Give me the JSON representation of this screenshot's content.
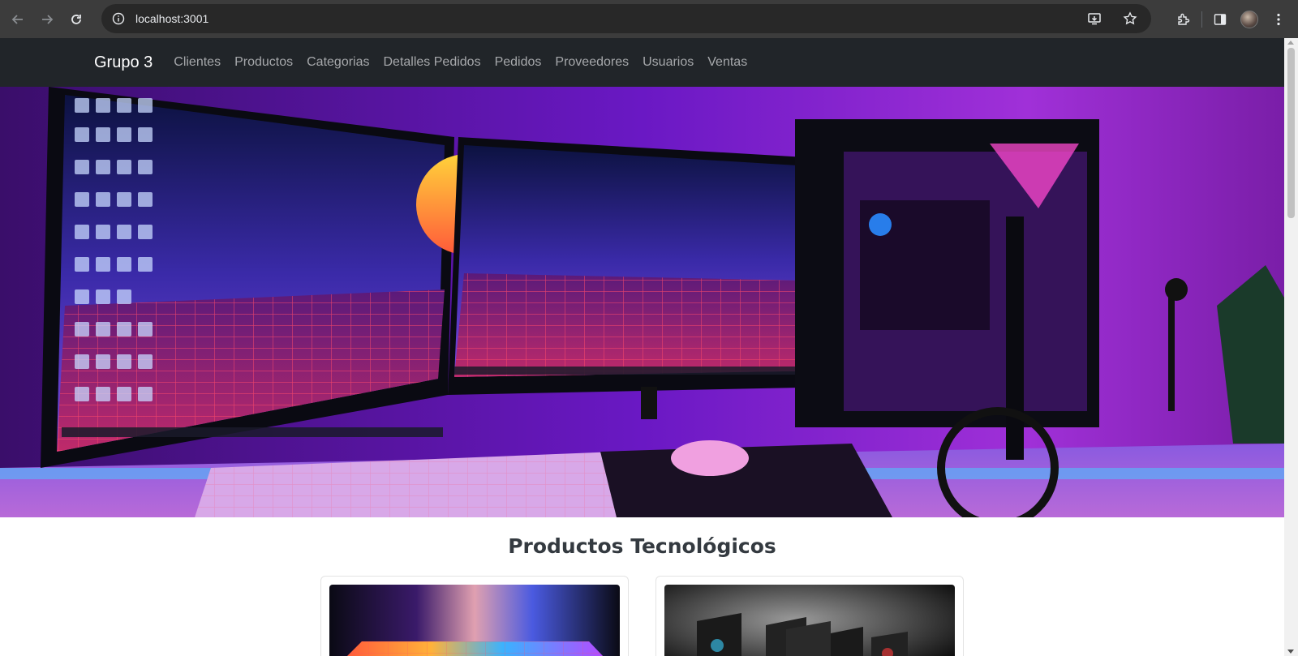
{
  "browser": {
    "url": "localhost:3001"
  },
  "navbar": {
    "brand": "Grupo 3",
    "links": [
      "Clientes",
      "Productos",
      "Categorias",
      "Detalles Pedidos",
      "Pedidos",
      "Proveedores",
      "Usuarios",
      "Ventas"
    ]
  },
  "hero": {
    "image": "gaming-setup-neon-photo"
  },
  "main": {
    "heading": "Productos Tecnológicos",
    "cards": [
      {
        "image": "laptop-colorful-keyboard-photo"
      },
      {
        "image": "pc-cases-lineup-photo"
      }
    ]
  },
  "colors": {
    "navbar_bg": "#212529",
    "nav_link": "#a6a8ab",
    "brand": "#ffffff",
    "heading": "#343a40"
  }
}
